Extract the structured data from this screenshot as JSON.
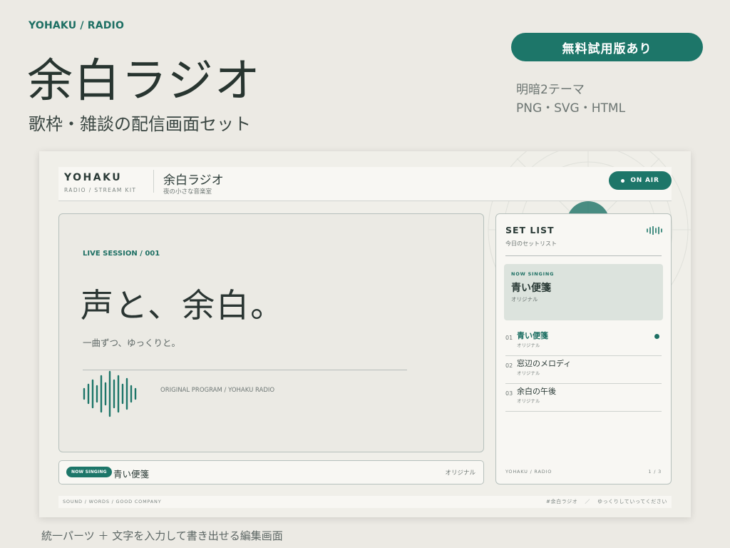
{
  "header": {
    "brand_tag": "YOHAKU / RADIO",
    "title": "余白ラジオ",
    "subtitle": "歌枠・雑談の配信画面セット",
    "trial_button": "無料試用版あり",
    "meta_line_1": "明暗2テーマ",
    "meta_line_2": "PNG・SVG・HTML"
  },
  "mockup": {
    "topbar": {
      "brand": "YOHAKU",
      "brand_sub": "RADIO / STREAM KIT",
      "title": "余白ラジオ",
      "subtitle": "夜の小さな音楽室",
      "on_air": "ON AIR"
    },
    "main": {
      "session_label": "LIVE SESSION / 001",
      "hero": "声と、余白。",
      "hero_sub": "一曲ずつ、ゆっくりと。",
      "program_label": "ORIGINAL PROGRAM / YOHAKU RADIO"
    },
    "now_playing": {
      "badge": "NOW SINGING",
      "title": "青い便箋",
      "meta": "オリジナル"
    },
    "setlist": {
      "title": "SET LIST",
      "subtitle": "今日のセットリスト",
      "now_label": "NOW SINGING",
      "now_title": "青い便箋",
      "now_sub": "オリジナル",
      "items": [
        {
          "num": "01",
          "name": "青い便箋",
          "tag": "オリジナル",
          "active": true
        },
        {
          "num": "02",
          "name": "窓辺のメロディ",
          "tag": "オリジナル",
          "active": false
        },
        {
          "num": "03",
          "name": "余白の午後",
          "tag": "オリジナル",
          "active": false
        }
      ],
      "footer_left": "YOHAKU / RADIO",
      "footer_right": "1 / 3"
    },
    "bottombar": {
      "left": "SOUND / WORDS / GOOD COMPANY",
      "right_1": "#余白ラジオ",
      "right_sep": "／",
      "right_2": "ゆっくりしていってください"
    }
  },
  "caption": "統一パーツ ＋ 文字を入力して書き出せる編集画面",
  "colors": {
    "accent": "#1d7669",
    "background": "#eceae4",
    "card": "#f8f7f3",
    "now_highlight": "#dce3dd"
  }
}
